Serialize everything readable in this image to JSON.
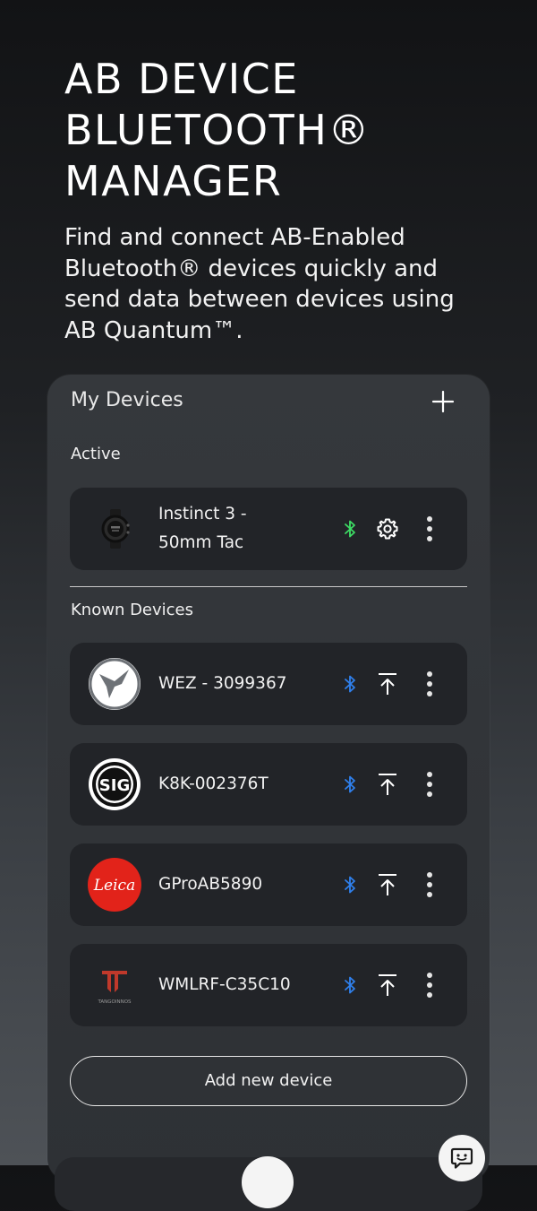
{
  "hero": {
    "title_lines": [
      "AB DEVICE",
      "BLUETOOTH®",
      "MANAGER"
    ],
    "subtitle_lines": [
      "Find and connect AB-Enabled",
      "Bluetooth® devices quickly and",
      "send data between devices using",
      "AB Quantum™."
    ]
  },
  "panel": {
    "title": "My Devices",
    "active_label": "Active",
    "known_label": "Known Devices",
    "add_device_label": "Add new device"
  },
  "active_device": {
    "name": "Instinct 3 -\n50mm Tac",
    "logo": "watch-thumbnail",
    "status_color": "#3ddc64"
  },
  "known_devices": [
    {
      "name": "WEZ - 3099367",
      "logo": "swallow-logo-icon",
      "status_color": "#2f80ed"
    },
    {
      "name": "K8K-002376T",
      "logo": "sig-logo-icon",
      "status_color": "#2f80ed"
    },
    {
      "name": "GProAB5890",
      "logo": "leica-logo-icon",
      "status_color": "#2f80ed",
      "logo_text": "Leica"
    },
    {
      "name": "WMLRF-C35C10",
      "logo": "tangoinnos-logo-icon",
      "status_color": "#2f80ed",
      "logo_text": "TANGOINNOS"
    }
  ],
  "icons": {
    "add": "plus-icon",
    "bluetooth": "bluetooth-icon",
    "settings": "gear-icon",
    "upload": "upload-icon",
    "more": "more-vertical-icon",
    "chat": "chat-icon"
  },
  "colors": {
    "card_bg": "#222428",
    "panel_bg": "#35383c",
    "active_bt": "#3ddc64",
    "known_bt": "#2f80ed",
    "leica_red": "#e2231a"
  }
}
